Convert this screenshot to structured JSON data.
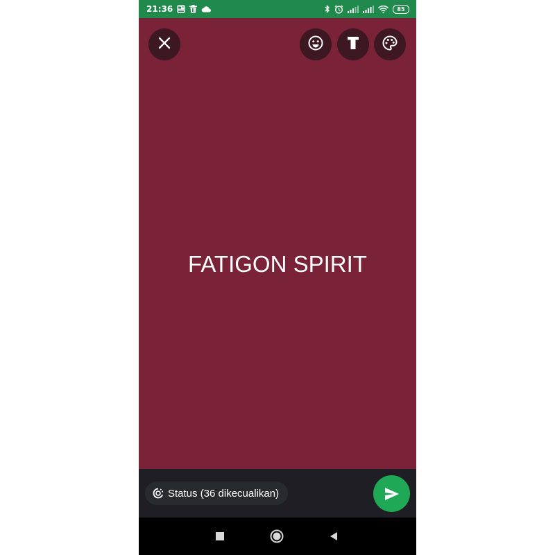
{
  "status_bar": {
    "time": "21:36",
    "battery": "85",
    "left_icons": [
      "news-icon",
      "trash-icon",
      "cloud-icon"
    ],
    "right_icons": [
      "bluetooth-icon",
      "alarm-icon",
      "signal-icon",
      "signal-icon",
      "wifi-icon",
      "battery-icon"
    ]
  },
  "toolbar": {
    "close_icon": "close-icon",
    "emoji_icon": "emoji-icon",
    "text_icon": "text-tool-icon",
    "palette_icon": "palette-icon"
  },
  "canvas": {
    "background_color": "#7a2238",
    "text": "FATIGON SPIRIT"
  },
  "bottom_bar": {
    "audience_label": "Status (36 dikecualikan)",
    "send_color": "#1fa855"
  },
  "nav_bar": {
    "buttons": [
      "recent-apps-icon",
      "home-icon",
      "back-icon"
    ]
  }
}
